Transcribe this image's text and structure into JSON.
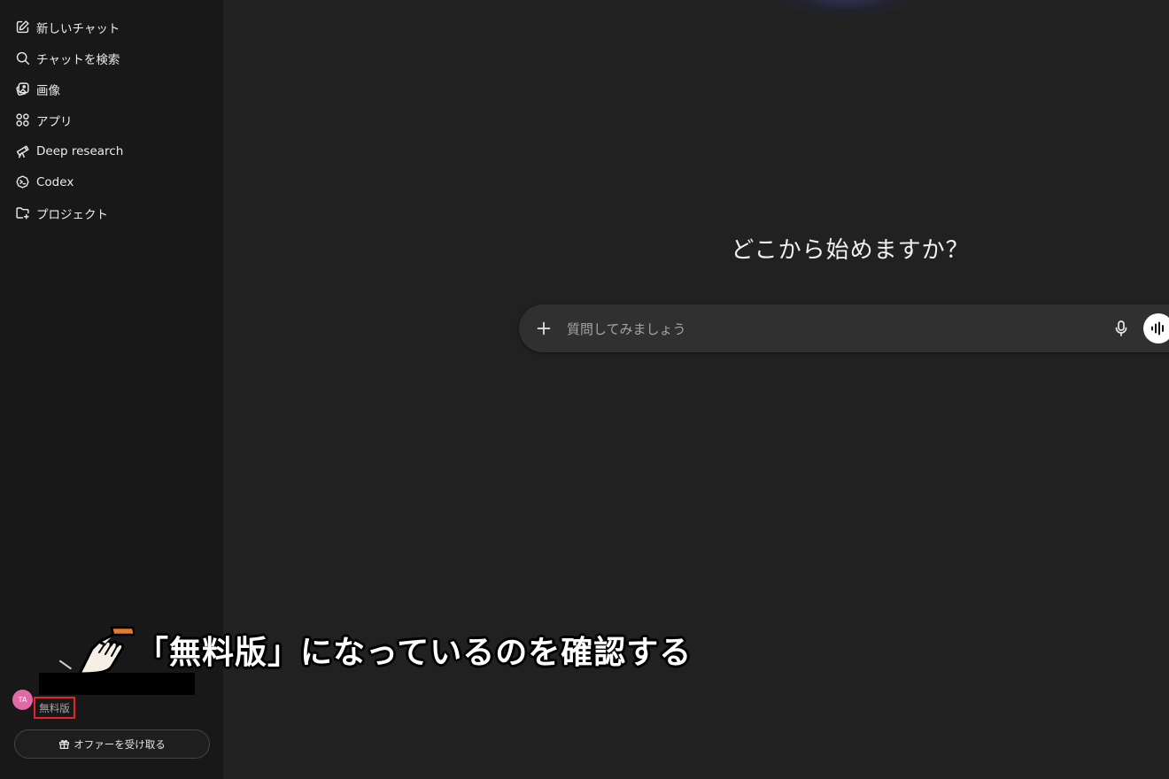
{
  "sidebar": {
    "items": [
      {
        "label": "新しいチャット",
        "icon": "edit-icon"
      },
      {
        "label": "チャットを検索",
        "icon": "search-icon"
      },
      {
        "label": "画像",
        "icon": "image-icon"
      },
      {
        "label": "アプリ",
        "icon": "apps-icon"
      },
      {
        "label": "Deep research",
        "icon": "telescope-icon"
      },
      {
        "label": "Codex",
        "icon": "codex-icon"
      },
      {
        "label": "プロジェクト",
        "icon": "folder-plus-icon"
      }
    ],
    "user": {
      "initials": "TA",
      "plan": "無料版",
      "avatar_color": "#e06aa6"
    },
    "offer_button": "オファーを受け取る"
  },
  "main": {
    "heading": "どこから始めますか？",
    "composer": {
      "placeholder": "質問してみましょう",
      "value": ""
    }
  },
  "annotation": {
    "text": "「無料版」になっているのを確認する",
    "highlight_color": "#e3262e"
  }
}
